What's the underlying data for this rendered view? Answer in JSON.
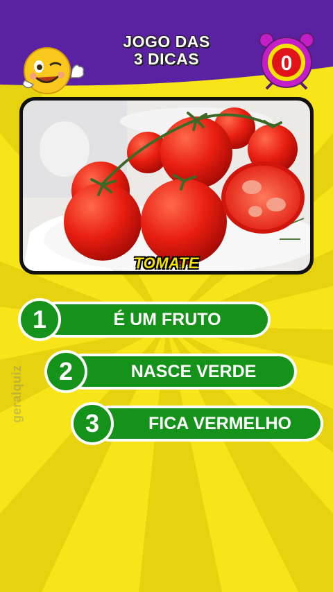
{
  "header": {
    "title_line1": "JOGO DAS",
    "title_line2": "3 DICAS"
  },
  "timer": {
    "value": "0"
  },
  "answer": {
    "label": "TOMATE"
  },
  "hints": [
    {
      "number": "1",
      "text": "É UM FRUTO"
    },
    {
      "number": "2",
      "text": "NASCE VERDE"
    },
    {
      "number": "3",
      "text": "FICA VERMELHO"
    }
  ],
  "watermark": "geralquiz",
  "colors": {
    "header_purple": "#5a22a3",
    "background_yellow": "#f7e51a",
    "hint_green": "#159219",
    "timer_pink": "#c41ec7",
    "timer_red": "#e0151a",
    "answer_yellow": "#f5e400"
  },
  "icons": {
    "emoji": "winking-face-emoji-icon",
    "timer": "alarm-clock-icon"
  }
}
